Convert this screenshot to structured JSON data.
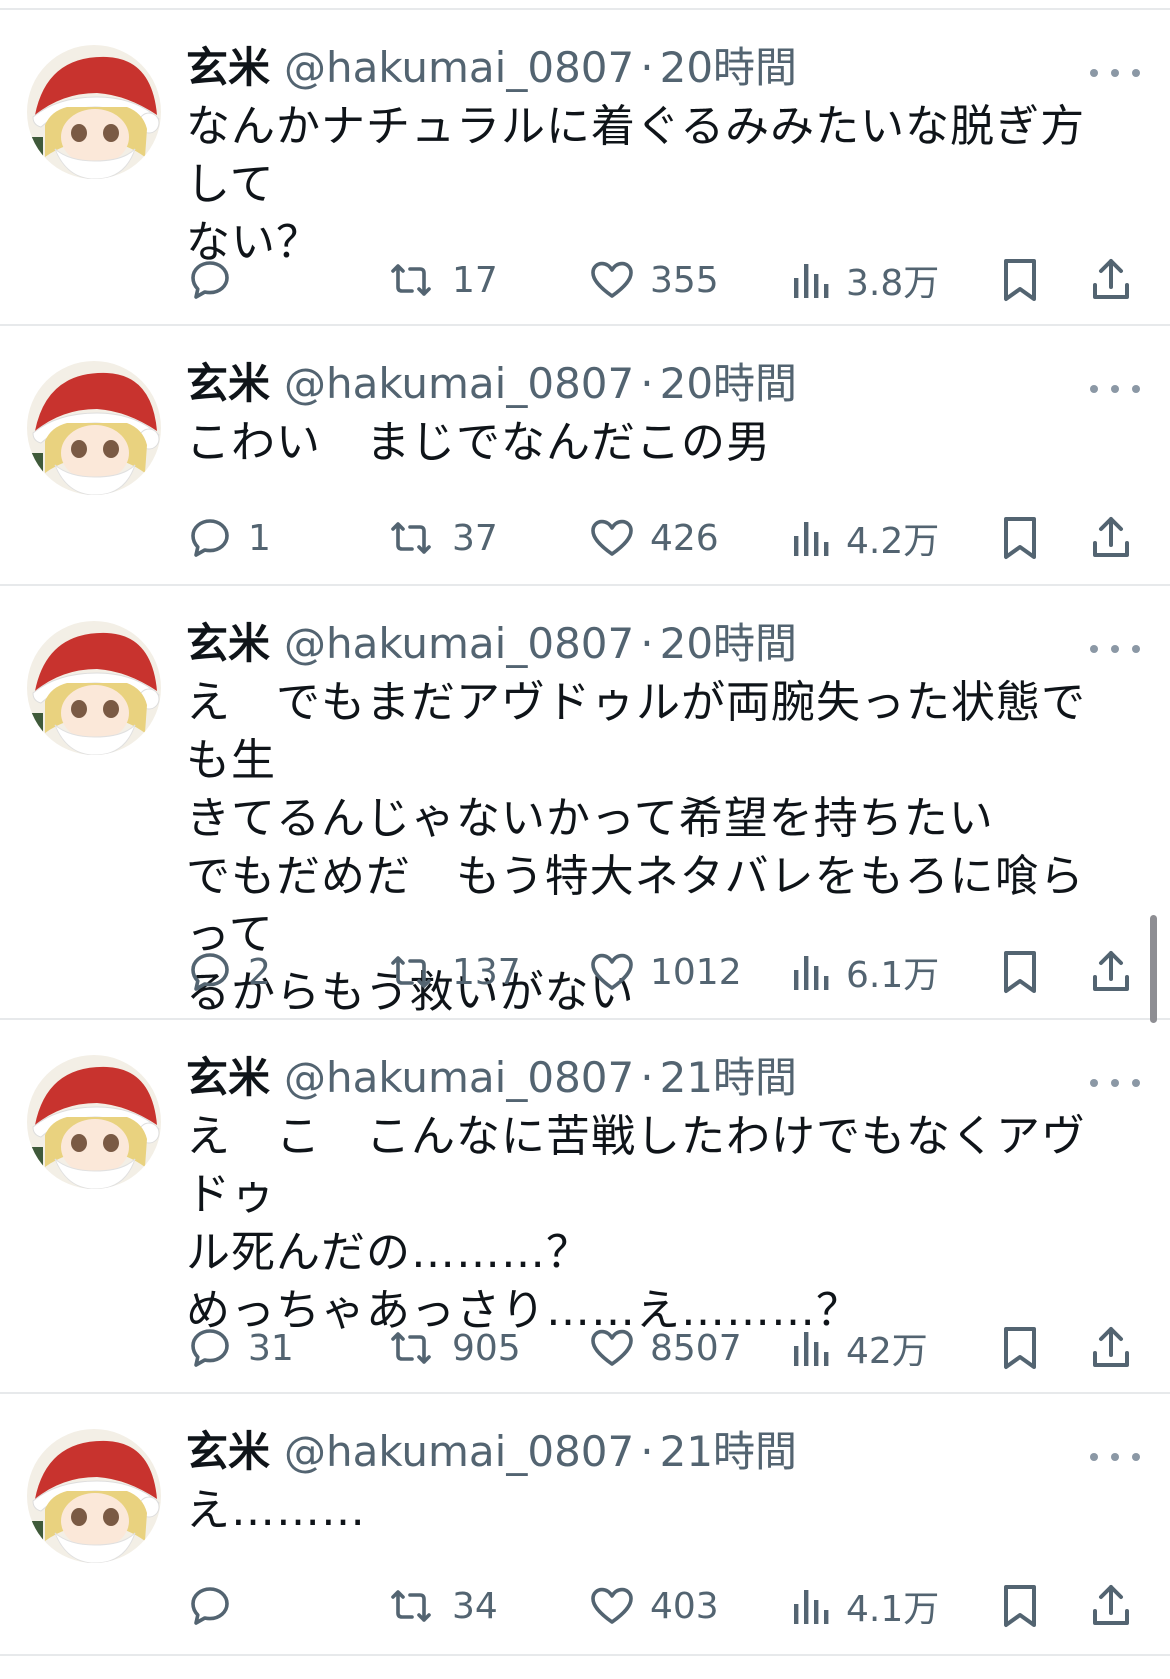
{
  "user": {
    "name": "玄米",
    "handle": "@hakumai_0807",
    "separator": "·"
  },
  "colors": {
    "text": "#0f1419",
    "secondary": "#536471",
    "divider": "#e7e9eb"
  },
  "icons": {
    "reply": "speech-bubble",
    "retweet": "retweet-arrows",
    "like": "heart",
    "views": "bar-chart",
    "bookmark": "bookmark",
    "share": "share-upload",
    "more": "three-dots"
  },
  "tweets": [
    {
      "time": "20時間",
      "text": "なんかナチュラルに着ぐるみみたいな脱ぎ方して\nない？",
      "replies": "",
      "retweets": "17",
      "likes": "355",
      "views": "3.8万"
    },
    {
      "time": "20時間",
      "text": "こわい　まじでなんだこの男",
      "replies": "1",
      "retweets": "37",
      "likes": "426",
      "views": "4.2万"
    },
    {
      "time": "20時間",
      "text": "え　でもまだアヴドゥルが両腕失った状態でも生\nきてるんじゃないかって希望を持ちたい\nでもだめだ　もう特大ネタバレをもろに喰らって\nるからもう救いがない",
      "replies": "2",
      "retweets": "137",
      "likes": "1012",
      "views": "6.1万"
    },
    {
      "time": "21時間",
      "text": "え　こ　こんなに苦戦したわけでもなくアヴドゥ\nル死んだの………？\nめっちゃあっさり……え………？",
      "replies": "31",
      "retweets": "905",
      "likes": "8507",
      "views": "42万"
    },
    {
      "time": "21時間",
      "text": "え………",
      "replies": "",
      "retweets": "34",
      "likes": "403",
      "views": "4.1万"
    }
  ]
}
